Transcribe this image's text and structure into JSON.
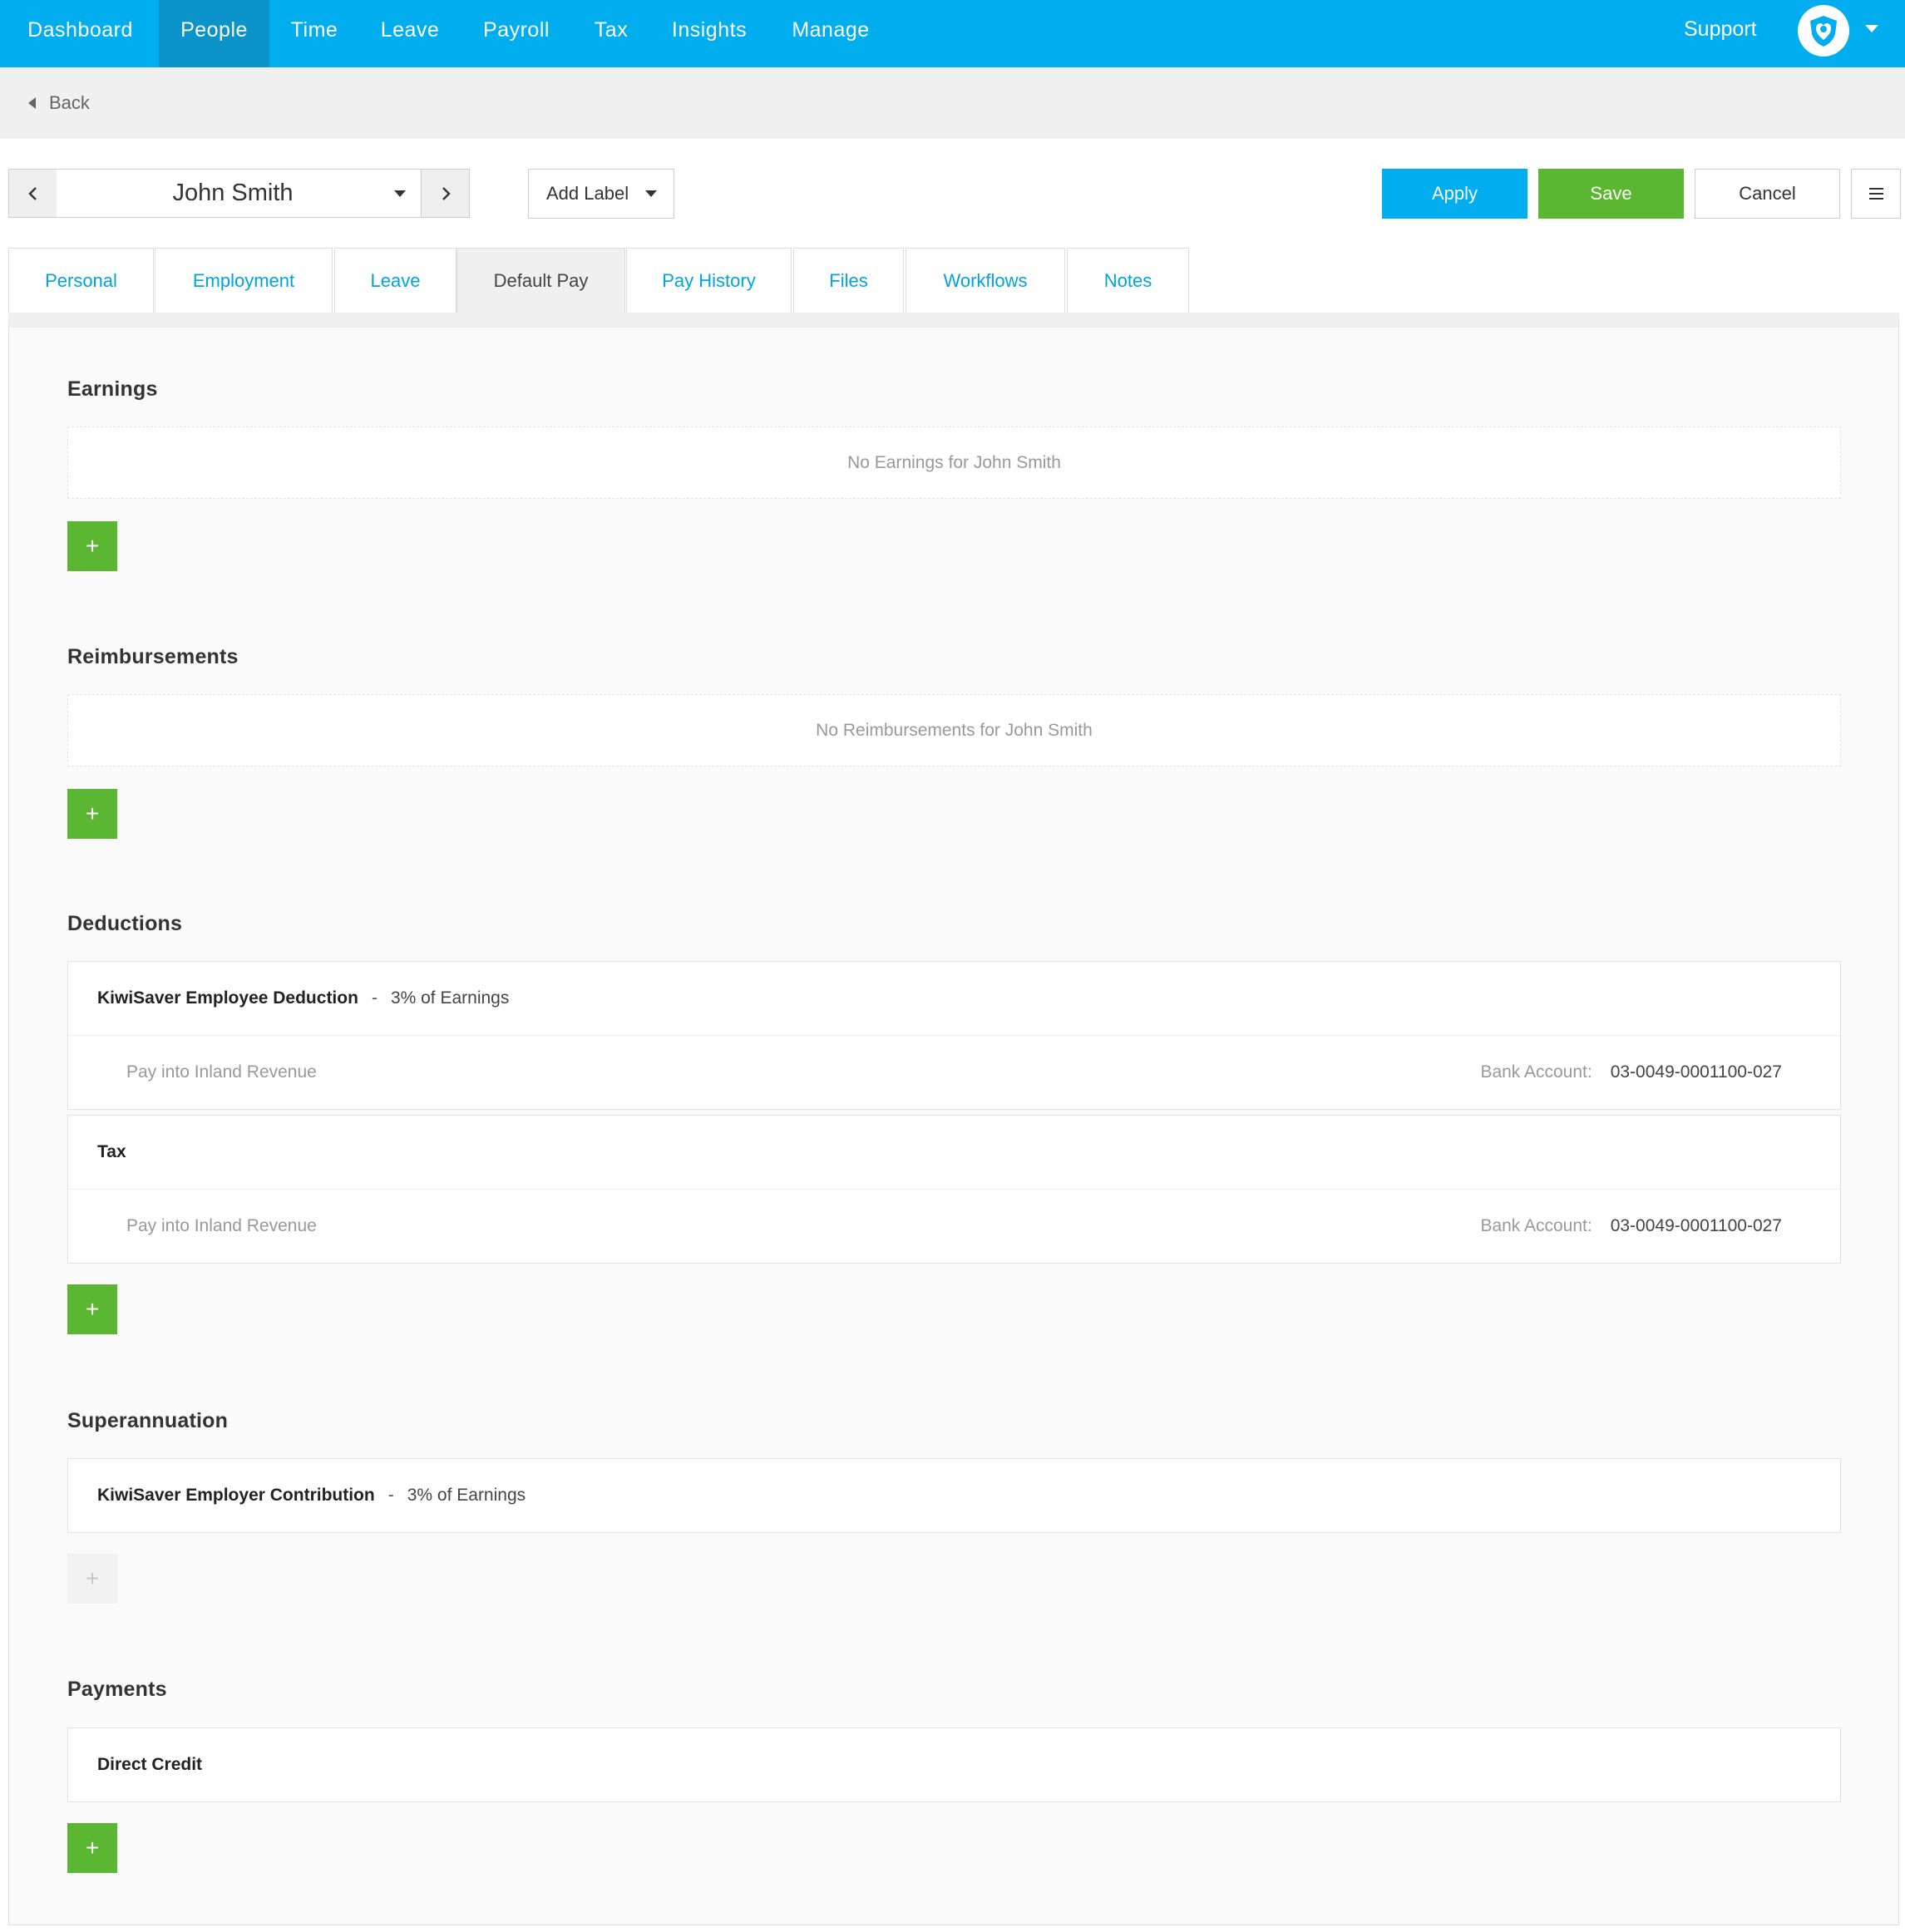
{
  "nav": {
    "items": [
      "Dashboard",
      "People",
      "Time",
      "Leave",
      "Payroll",
      "Tax",
      "Insights",
      "Manage"
    ],
    "active": "People",
    "support_label": "Support"
  },
  "back": {
    "label": "Back"
  },
  "toolbar": {
    "employee_name": "John Smith",
    "add_label": "Add Label",
    "apply_label": "Apply",
    "save_label": "Save",
    "cancel_label": "Cancel"
  },
  "tabs": [
    "Personal",
    "Employment",
    "Leave",
    "Default Pay",
    "Pay History",
    "Files",
    "Workflows",
    "Notes"
  ],
  "active_tab": "Default Pay",
  "sections": {
    "earnings": {
      "title": "Earnings",
      "empty_text": "No Earnings for John Smith"
    },
    "reimbursements": {
      "title": "Reimbursements",
      "empty_text": "No Reimbursements for John Smith"
    },
    "deductions": {
      "title": "Deductions",
      "items": [
        {
          "name": "KiwiSaver Employee Deduction",
          "separator": "-",
          "rate": "3% of Earnings",
          "pay_into": "Pay into Inland Revenue",
          "bank_label": "Bank Account:",
          "bank_value": "03-0049-0001100-027"
        },
        {
          "name": "Tax",
          "pay_into": "Pay into Inland Revenue",
          "bank_label": "Bank Account:",
          "bank_value": "03-0049-0001100-027"
        }
      ]
    },
    "superannuation": {
      "title": "Superannuation",
      "items": [
        {
          "name": "KiwiSaver Employer Contribution",
          "separator": "-",
          "rate": "3% of Earnings"
        }
      ]
    },
    "payments": {
      "title": "Payments",
      "items": [
        {
          "name": "Direct Credit"
        }
      ]
    }
  },
  "add_symbol": "+",
  "icons": {
    "prev": "chevron-left-icon",
    "next": "chevron-right-icon",
    "menu": "hamburger-menu-icon",
    "avatar": "shield-heart-logo-icon"
  },
  "colors": {
    "nav": "#00aeef",
    "nav_active": "#0a94c9",
    "apply": "#00aeef",
    "save": "#5bb632",
    "tab_link": "#00a3e0"
  }
}
